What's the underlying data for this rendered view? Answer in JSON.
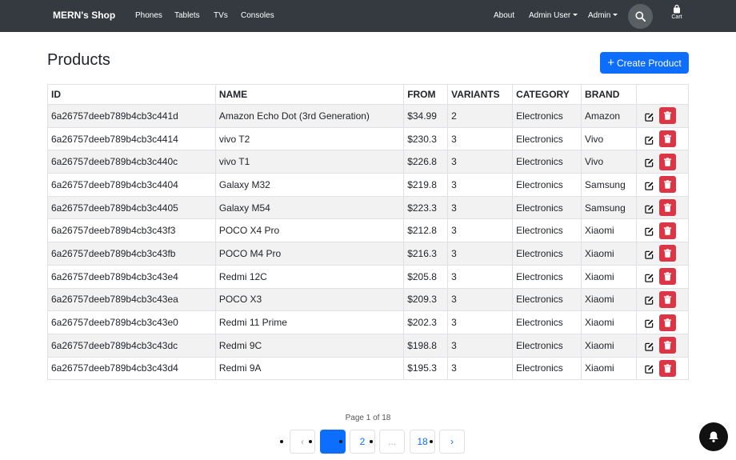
{
  "nav": {
    "brand": "MERN's Shop",
    "links": [
      "Phones",
      "Tablets",
      "TVs",
      "Consoles"
    ],
    "about": "About",
    "admin_user": "Admin User",
    "admin": "Admin",
    "cart": "Cart"
  },
  "page": {
    "title": "Products",
    "create_button": "Create Product"
  },
  "table": {
    "headers": [
      "ID",
      "NAME",
      "FROM",
      "VARIANTS",
      "CATEGORY",
      "BRAND"
    ],
    "rows": [
      [
        "6a26757deeb789b4cb3c441d",
        "Amazon Echo Dot (3rd Generation)",
        "$34.99",
        "2",
        "Electronics",
        "Amazon"
      ],
      [
        "6a26757deeb789b4cb3c4414",
        "vivo T2",
        "$230.3",
        "3",
        "Electronics",
        "Vivo"
      ],
      [
        "6a26757deeb789b4cb3c440c",
        "vivo T1",
        "$226.8",
        "3",
        "Electronics",
        "Vivo"
      ],
      [
        "6a26757deeb789b4cb3c4404",
        "Galaxy M32",
        "$219.8",
        "3",
        "Electronics",
        "Samsung"
      ],
      [
        "6a26757deeb789b4cb3c4405",
        "Galaxy M54",
        "$223.3",
        "3",
        "Electronics",
        "Samsung"
      ],
      [
        "6a26757deeb789b4cb3c43f3",
        "POCO X4 Pro",
        "$212.8",
        "3",
        "Electronics",
        "Xiaomi"
      ],
      [
        "6a26757deeb789b4cb3c43fb",
        "POCO M4 Pro",
        "$216.3",
        "3",
        "Electronics",
        "Xiaomi"
      ],
      [
        "6a26757deeb789b4cb3c43e4",
        "Redmi 12C",
        "$205.8",
        "3",
        "Electronics",
        "Xiaomi"
      ],
      [
        "6a26757deeb789b4cb3c43ea",
        "POCO X3",
        "$209.3",
        "3",
        "Electronics",
        "Xiaomi"
      ],
      [
        "6a26757deeb789b4cb3c43e0",
        "Redmi 11 Prime",
        "$202.3",
        "3",
        "Electronics",
        "Xiaomi"
      ],
      [
        "6a26757deeb789b4cb3c43dc",
        "Redmi 9C",
        "$198.8",
        "3",
        "Electronics",
        "Xiaomi"
      ],
      [
        "6a26757deeb789b4cb3c43d4",
        "Redmi 9A",
        "$195.3",
        "3",
        "Electronics",
        "Xiaomi"
      ]
    ]
  },
  "pagination": {
    "info": "Page 1 of 18",
    "prev": "‹",
    "current": "",
    "page2": "2",
    "ellipsis": "...",
    "last": "18",
    "next": "›"
  },
  "icons": {
    "search": "search-icon",
    "cart": "shopping-bag-icon",
    "create": "plus-icon",
    "edit": "edit-icon",
    "delete": "trash-icon",
    "notifications": "bell-icon"
  },
  "colors": {
    "navbar": "#343a40",
    "primary": "#0d6efd",
    "danger": "#dc3545",
    "striped_row": "#f2f2f2"
  }
}
